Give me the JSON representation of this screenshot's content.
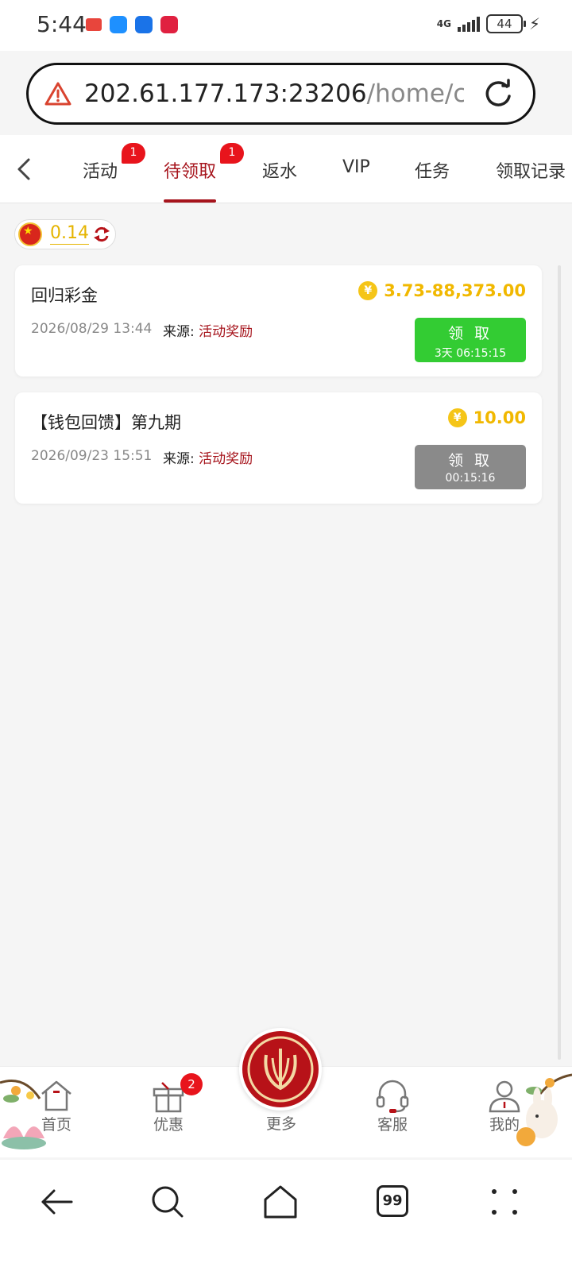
{
  "status_bar": {
    "time": "5:44",
    "network": "4G",
    "battery": "44",
    "app_icons": [
      "book-icon",
      "message-icon",
      "weather-icon",
      "xiaohongshu-icon"
    ]
  },
  "browser": {
    "url_host": "202.61.177.173:23206",
    "url_path": "/home/canR"
  },
  "tabs": [
    {
      "label": "活动",
      "badge": "1"
    },
    {
      "label": "待领取",
      "badge": "1",
      "active": true
    },
    {
      "label": "返水"
    },
    {
      "label": "VIP"
    },
    {
      "label": "任务"
    },
    {
      "label": "领取记录"
    }
  ],
  "balance": {
    "value": "0.14",
    "currency_flag": "china-flag-icon"
  },
  "rewards": [
    {
      "title": "回归彩金",
      "amount": "3.73-88,373.00",
      "date": "2026/08/29 13:44",
      "source_label": "来源:",
      "source_value": "活动奖励",
      "button_label": "领 取",
      "button_timer": "3天 06:15:15",
      "button_state": "enabled"
    },
    {
      "title": "【钱包回馈】第九期",
      "amount": "10.00",
      "date": "2026/09/23 15:51",
      "source_label": "来源:",
      "source_value": "活动奖励",
      "button_label": "领 取",
      "button_timer": "00:15:16",
      "button_state": "disabled"
    }
  ],
  "coin_symbol": "¥",
  "bottom_nav": {
    "home": "首页",
    "offers": "优惠",
    "offers_badge": "2",
    "more": "更多",
    "support": "客服",
    "mine": "我的"
  },
  "system_nav": {
    "tabs_count": "99"
  },
  "colors": {
    "brand_red": "#a6141c",
    "claim_green": "#33cc33",
    "claim_disabled": "#8a8a8a",
    "amount_gold": "#f1b800"
  }
}
